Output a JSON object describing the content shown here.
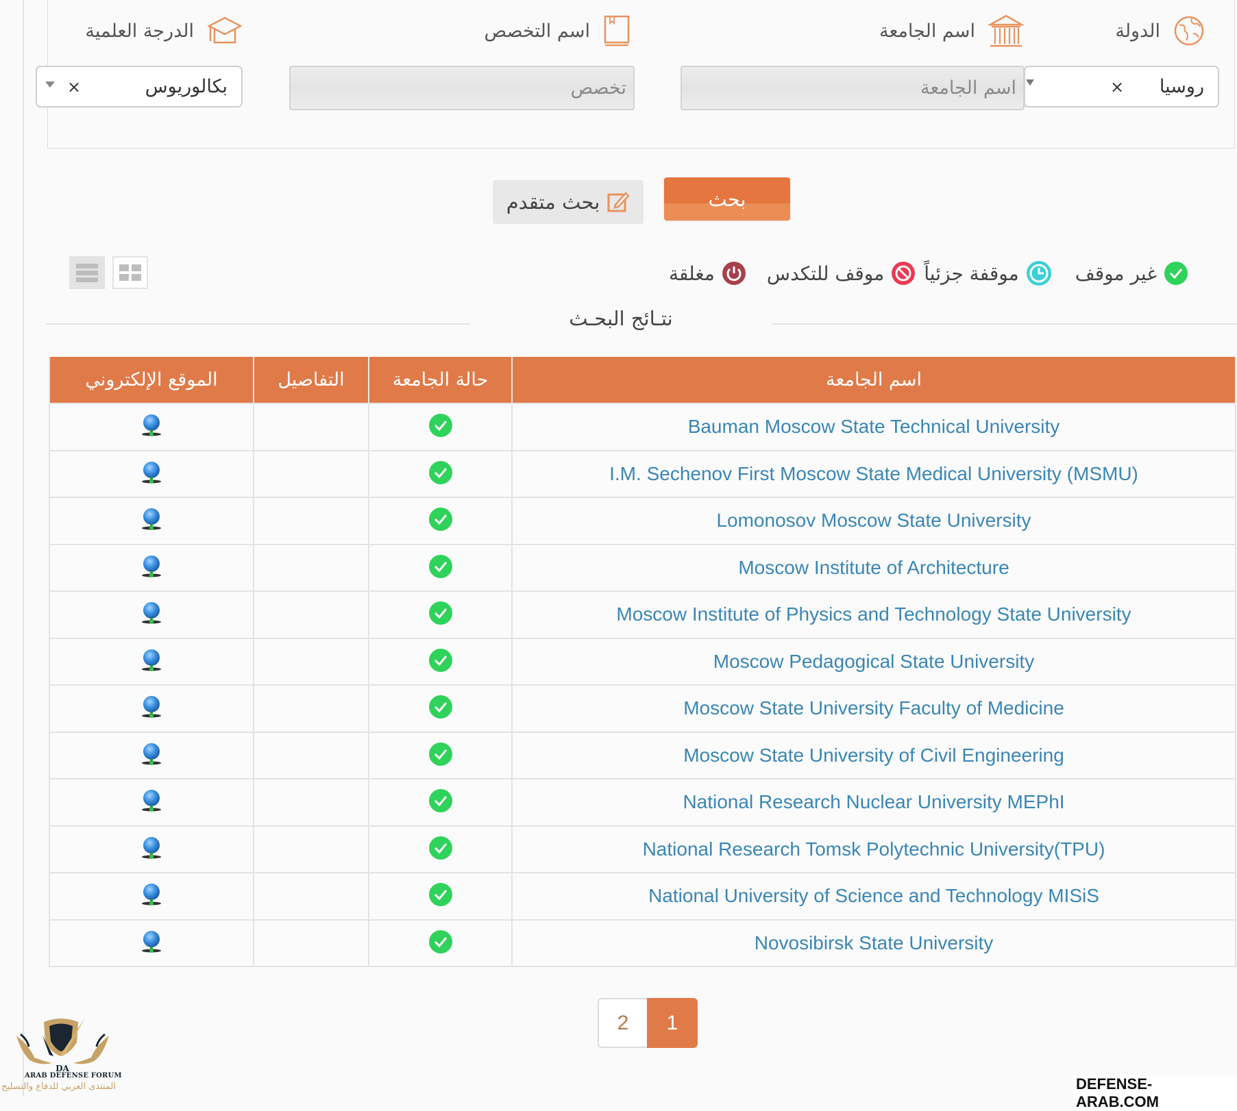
{
  "filters": {
    "country": {
      "label": "الدولة",
      "icon": "globe-icon",
      "value": "روسيا",
      "clear": "×"
    },
    "university": {
      "label": "اسم الجامعة",
      "icon": "university-building-icon",
      "placeholder": "اسم الجامعة"
    },
    "specialty": {
      "label": "اسم التخصص",
      "icon": "book-icon",
      "placeholder": "تخصص"
    },
    "degree": {
      "label": "الدرجة العلمية",
      "icon": "graduation-cap-icon",
      "value": "بكالوريوس",
      "clear": "×"
    }
  },
  "actions": {
    "search_label": "بحث",
    "advanced_label": "بحث متقدم"
  },
  "legend": [
    {
      "label": "غير موقف",
      "icon": "check-circle-icon",
      "color": "#2fd25a"
    },
    {
      "label": "موقفة جزئياً",
      "icon": "clock-icon",
      "color": "#3bd0d6"
    },
    {
      "label": "موقف للتكدس",
      "icon": "ban-icon",
      "color": "#ec3a55"
    },
    {
      "label": "مغلقة",
      "icon": "power-icon",
      "color": "#a8404b"
    }
  ],
  "results": {
    "title": "نتـائج البحـث",
    "columns": [
      "اسم الجامعة",
      "حالة الجامعة",
      "التفاصيل",
      "الموقع الإلكتروني"
    ],
    "rows": [
      {
        "name": "Bauman Moscow State Technical University",
        "status": "open"
      },
      {
        "name": "I.M. Sechenov First Moscow State Medical University (MSMU)",
        "status": "open"
      },
      {
        "name": "Lomonosov Moscow State University",
        "status": "open"
      },
      {
        "name": "Moscow Institute of Architecture",
        "status": "open"
      },
      {
        "name": "Moscow Institute of Physics and Technology State University",
        "status": "open"
      },
      {
        "name": "Moscow Pedagogical State University",
        "status": "open"
      },
      {
        "name": "Moscow State University Faculty of Medicine",
        "status": "open"
      },
      {
        "name": "Moscow State University of Civil Engineering",
        "status": "open"
      },
      {
        "name": "National Research Nuclear University MEPhI",
        "status": "open"
      },
      {
        "name": "National Research Tomsk Polytechnic University(TPU)",
        "status": "open"
      },
      {
        "name": "National University of Science and Technology MISiS",
        "status": "open"
      },
      {
        "name": "Novosibirsk State University",
        "status": "open"
      }
    ]
  },
  "pagination": {
    "pages": [
      "1",
      "2"
    ],
    "current": "1"
  },
  "branding": {
    "logo_mark": "DA",
    "logo_en": "ARAB DEFENSE FORUM",
    "logo_ar": "المنتدى العربي للدفاع والتسليح",
    "watermark": "DEFENSE-ARAB.COM"
  },
  "colors": {
    "accent": "#e07a48",
    "link": "#3a86b4",
    "icon_orange": "#e8935e"
  }
}
